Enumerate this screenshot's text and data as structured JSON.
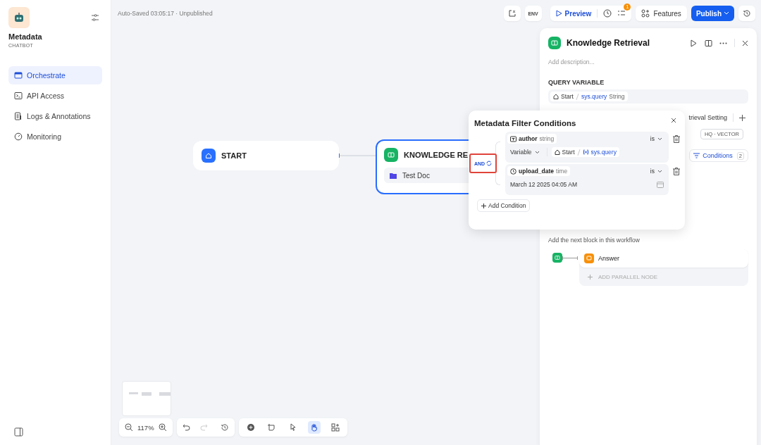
{
  "sidebar": {
    "app_name": "Metadata",
    "app_type": "CHATBOT",
    "nav": [
      {
        "kind": "orchestrate",
        "label": "Orchestrate",
        "selected": true
      },
      {
        "kind": "api",
        "label": "API Access",
        "selected": false
      },
      {
        "kind": "logs",
        "label": "Logs & Annotations",
        "selected": false
      },
      {
        "kind": "monitoring",
        "label": "Monitoring",
        "selected": false
      }
    ]
  },
  "status": "Auto-Saved 03:05:17 · Unpublished",
  "toolbar": {
    "env": "ENV",
    "preview": "Preview",
    "checklist_badge": "1",
    "features": "Features",
    "publish": "Publish"
  },
  "nodes": [
    {
      "kind": "start",
      "title": "START",
      "selected": false
    },
    {
      "kind": "knowledge",
      "title": "KNOWLEDGE RE",
      "selected": true,
      "dataset": "Test Doc"
    }
  ],
  "zoom": "117%",
  "tools": [
    {
      "kind": "add",
      "selected": false
    },
    {
      "kind": "note",
      "selected": false
    },
    {
      "kind": "pointer",
      "selected": false
    },
    {
      "kind": "hand",
      "selected": true
    },
    {
      "kind": "layout",
      "selected": false
    }
  ],
  "panel": {
    "title": "Knowledge Retrieval",
    "description_placeholder": "Add description...",
    "query_label": "QUERY VARIABLE",
    "query": {
      "node": "Start",
      "variable": "sys.query",
      "type": "String"
    },
    "retrieval_setting": "trieval Setting",
    "retrieval_mode": "HQ · VECTOR",
    "conditions": "Conditions",
    "conditions_count": "2",
    "next_label": "Add the next block in this workflow",
    "next_node": "Answer",
    "add_parallel": "ADD PARALLEL NODE"
  },
  "filter_popup": {
    "title": "Metadata Filter Conditions",
    "logic": "AND",
    "logic_highlighted": true,
    "add": "Add Condition",
    "conditions": [
      {
        "kind": "string",
        "field": "author",
        "type": "string",
        "operator": "is",
        "value_source": "Variable",
        "value_node": "Start",
        "value_variable": "sys.query"
      },
      {
        "kind": "time",
        "field": "upload_date",
        "type": "time",
        "operator": "is",
        "value": "March 12 2025 04:05 AM"
      }
    ]
  }
}
